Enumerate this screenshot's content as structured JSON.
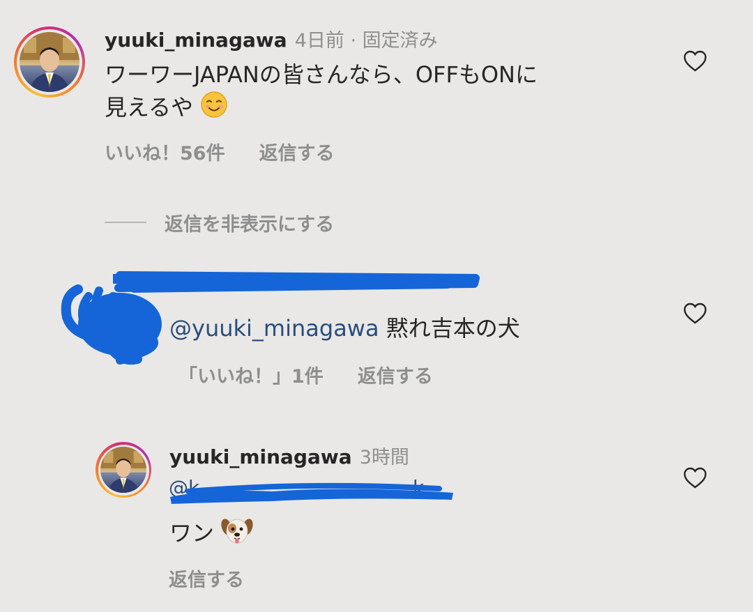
{
  "comment": {
    "username": "yuuki_minagawa",
    "meta": "4日前 · 固定済み",
    "text_line1": "ワーワーJAPANの皆さんなら、OFFもONに",
    "text_line2": "見えるや",
    "emoji": "smiling-face-emoji",
    "likes": "いいね！56件",
    "reply": "返信する"
  },
  "hide_replies": "返信を非表示にする",
  "reply1": {
    "mention": "@yuuki_minagawa",
    "text": "黙れ吉本の犬",
    "likes": "「いいね！」1件",
    "reply": "返信する"
  },
  "reply2": {
    "username": "yuuki_minagawa",
    "meta": "3時間",
    "text": "ワン",
    "emoji": "dog-face-emoji",
    "reply": "返信する"
  },
  "colors": {
    "background": "#e9e8e6",
    "text": "#262626",
    "secondary": "#8e8e8e",
    "mention": "#2a4d7c",
    "redaction": "#1565d8"
  }
}
